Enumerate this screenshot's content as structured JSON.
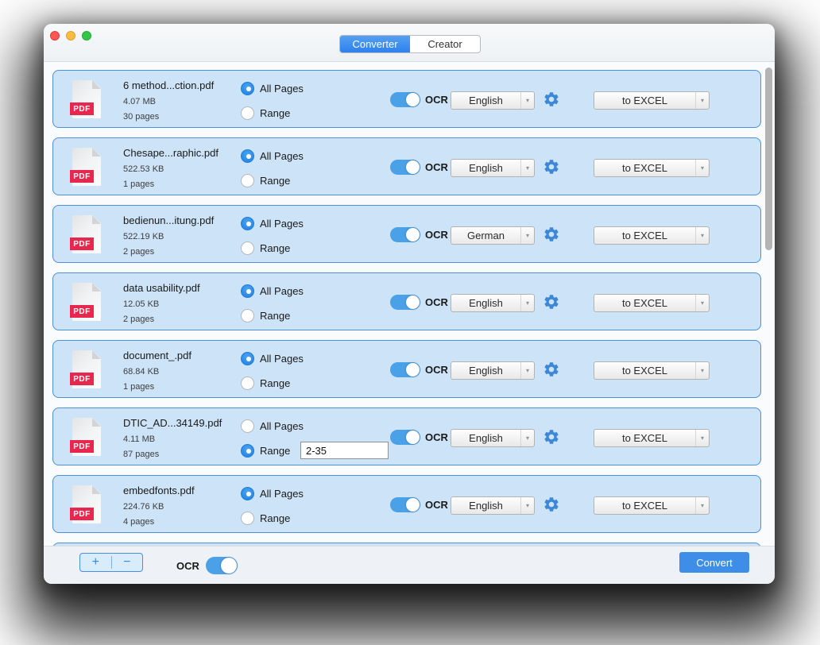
{
  "titlebar": {
    "tabs": [
      {
        "label": "Converter",
        "active": true
      },
      {
        "label": "Creator",
        "active": false
      }
    ]
  },
  "rows": [
    {
      "icon_label": "PDF",
      "filename": "6 method...ction.pdf",
      "size": "4.07 MB",
      "pages": "30 pages",
      "all_pages_label": "All Pages",
      "range_label": "Range",
      "page_mode": "all",
      "range_value": null,
      "ocr_on": true,
      "ocr_label": "OCR",
      "language": "English",
      "output": "to EXCEL"
    },
    {
      "icon_label": "PDF",
      "filename": "Chesape...raphic.pdf",
      "size": "522.53 KB",
      "pages": "1 pages",
      "all_pages_label": "All Pages",
      "range_label": "Range",
      "page_mode": "all",
      "range_value": null,
      "ocr_on": true,
      "ocr_label": "OCR",
      "language": "English",
      "output": "to EXCEL"
    },
    {
      "icon_label": "PDF",
      "filename": "bedienun...itung.pdf",
      "size": "522.19 KB",
      "pages": "2 pages",
      "all_pages_label": "All Pages",
      "range_label": "Range",
      "page_mode": "all",
      "range_value": null,
      "ocr_on": true,
      "ocr_label": "OCR",
      "language": "German",
      "output": "to EXCEL"
    },
    {
      "icon_label": "PDF",
      "filename": "data usability.pdf",
      "size": "12.05 KB",
      "pages": "2 pages",
      "all_pages_label": "All Pages",
      "range_label": "Range",
      "page_mode": "all",
      "range_value": null,
      "ocr_on": true,
      "ocr_label": "OCR",
      "language": "English",
      "output": "to EXCEL"
    },
    {
      "icon_label": "PDF",
      "filename": "document_.pdf",
      "size": "68.84 KB",
      "pages": "1 pages",
      "all_pages_label": "All Pages",
      "range_label": "Range",
      "page_mode": "all",
      "range_value": null,
      "ocr_on": true,
      "ocr_label": "OCR",
      "language": "English",
      "output": "to EXCEL"
    },
    {
      "icon_label": "PDF",
      "filename": "DTIC_AD...34149.pdf",
      "size": "4.11 MB",
      "pages": "87 pages",
      "all_pages_label": "All Pages",
      "range_label": "Range",
      "page_mode": "range",
      "range_value": "2-35",
      "ocr_on": true,
      "ocr_label": "OCR",
      "language": "English",
      "output": "to EXCEL"
    },
    {
      "icon_label": "PDF",
      "filename": "embedfonts.pdf",
      "size": "224.76 KB",
      "pages": "4 pages",
      "all_pages_label": "All Pages",
      "range_label": "Range",
      "page_mode": "all",
      "range_value": null,
      "ocr_on": true,
      "ocr_label": "OCR",
      "language": "English",
      "output": "to EXCEL"
    }
  ],
  "footer": {
    "add_label": "+",
    "remove_label": "−",
    "ocr_label": "OCR",
    "ocr_on": true,
    "convert_label": "Convert"
  },
  "colors": {
    "accent_blue": "#2e82ee",
    "row_background": "#cde3f7",
    "row_border": "#4a90da",
    "toggle_on": "#4aa1e8",
    "gear_blue": "#3d87d8",
    "pdf_badge_red": "#e8274e",
    "convert_button": "#3e8de9",
    "traffic_red": "#fc5753",
    "traffic_yellow": "#fdbc40",
    "traffic_green": "#33c748"
  }
}
